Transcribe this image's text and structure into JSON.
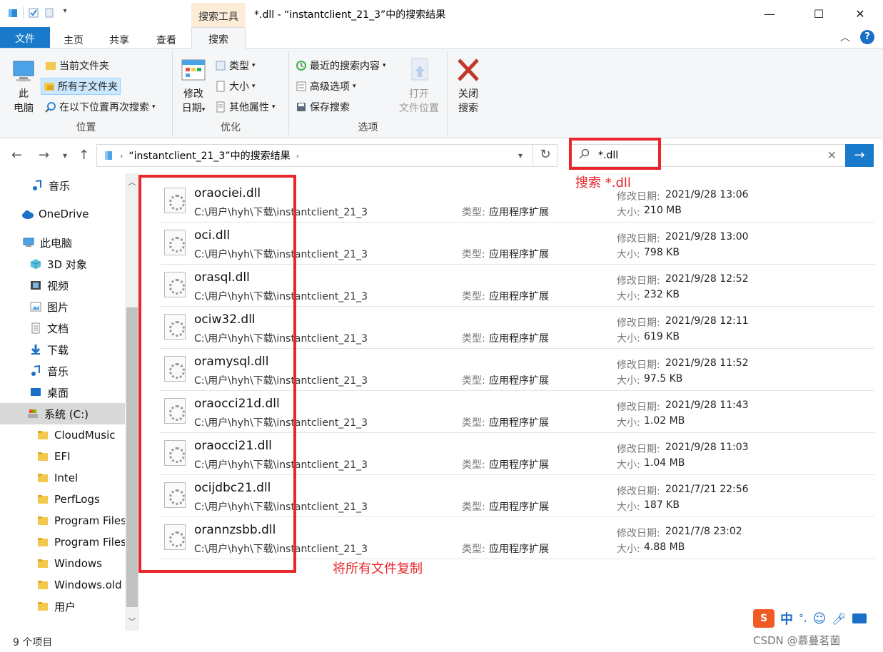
{
  "titlebar": {
    "contextual_tab": "搜索工具",
    "title": "*.dll - “instantclient_21_3”中的搜索结果",
    "minimize": "—",
    "maximize": "☐",
    "close": "✕"
  },
  "tabs": {
    "file": "文件",
    "home": "主页",
    "share": "共享",
    "view": "查看",
    "search": "搜索"
  },
  "ribbon": {
    "location": {
      "label": "位置",
      "this_pc_line1": "此",
      "this_pc_line2": "电脑",
      "current_folder": "当前文件夹",
      "all_subfolders": "所有子文件夹",
      "search_again": "在以下位置再次搜索"
    },
    "refine": {
      "label": "优化",
      "date_modified_line1": "修改",
      "date_modified_line2": "日期",
      "kind": "类型",
      "size": "大小",
      "other_props": "其他属性"
    },
    "options": {
      "label": "选项",
      "recent_searches": "最近的搜索内容",
      "advanced": "高级选项",
      "save_search": "保存搜索",
      "open_location_line1": "打开",
      "open_location_line2": "文件位置"
    },
    "close": {
      "line1": "关闭",
      "line2": "搜索"
    }
  },
  "address": {
    "path": "“instantclient_21_3”中的搜索结果",
    "search_value": "*.dll"
  },
  "sidebar": {
    "items": [
      {
        "label": "音乐",
        "icon": "music-icon"
      },
      {
        "label": "OneDrive",
        "icon": "cloud-icon"
      },
      {
        "label": "此电脑",
        "icon": "computer-icon"
      },
      {
        "label": "3D 对象",
        "icon": "cube-icon"
      },
      {
        "label": "视频",
        "icon": "film-icon"
      },
      {
        "label": "图片",
        "icon": "picture-icon"
      },
      {
        "label": "文档",
        "icon": "document-icon"
      },
      {
        "label": "下载",
        "icon": "download-icon"
      },
      {
        "label": "音乐",
        "icon": "music-icon"
      },
      {
        "label": "桌面",
        "icon": "desktop-icon"
      },
      {
        "label": "系统 (C:)",
        "icon": "drive-icon"
      },
      {
        "label": "CloudMusic",
        "icon": "folder-icon"
      },
      {
        "label": "EFI",
        "icon": "folder-icon"
      },
      {
        "label": "Intel",
        "icon": "folder-icon"
      },
      {
        "label": "PerfLogs",
        "icon": "folder-icon"
      },
      {
        "label": "Program Files",
        "icon": "folder-icon"
      },
      {
        "label": "Program Files",
        "icon": "folder-icon"
      },
      {
        "label": "Windows",
        "icon": "folder-icon"
      },
      {
        "label": "Windows.old",
        "icon": "folder-icon"
      },
      {
        "label": "用户",
        "icon": "folder-icon"
      }
    ]
  },
  "file_labels": {
    "type_label": "类型:",
    "date_label": "修改日期:",
    "size_label": "大小:"
  },
  "files": [
    {
      "name": "oraociei.dll",
      "path": "C:\\用户\\hyh\\下载\\instantclient_21_3",
      "type": "应用程序扩展",
      "date": "2021/9/28 13:06",
      "size": "210 MB"
    },
    {
      "name": "oci.dll",
      "path": "C:\\用户\\hyh\\下载\\instantclient_21_3",
      "type": "应用程序扩展",
      "date": "2021/9/28 13:00",
      "size": "798 KB"
    },
    {
      "name": "orasql.dll",
      "path": "C:\\用户\\hyh\\下载\\instantclient_21_3",
      "type": "应用程序扩展",
      "date": "2021/9/28 12:52",
      "size": "232 KB"
    },
    {
      "name": "ociw32.dll",
      "path": "C:\\用户\\hyh\\下载\\instantclient_21_3",
      "type": "应用程序扩展",
      "date": "2021/9/28 12:11",
      "size": "619 KB"
    },
    {
      "name": "oramysql.dll",
      "path": "C:\\用户\\hyh\\下载\\instantclient_21_3",
      "type": "应用程序扩展",
      "date": "2021/9/28 11:52",
      "size": "97.5 KB"
    },
    {
      "name": "oraocci21d.dll",
      "path": "C:\\用户\\hyh\\下载\\instantclient_21_3",
      "type": "应用程序扩展",
      "date": "2021/9/28 11:43",
      "size": "1.02 MB"
    },
    {
      "name": "oraocci21.dll",
      "path": "C:\\用户\\hyh\\下载\\instantclient_21_3",
      "type": "应用程序扩展",
      "date": "2021/9/28 11:03",
      "size": "1.04 MB"
    },
    {
      "name": "ocijdbc21.dll",
      "path": "C:\\用户\\hyh\\下载\\instantclient_21_3",
      "type": "应用程序扩展",
      "date": "2021/7/21 22:56",
      "size": "187 KB"
    },
    {
      "name": "orannzsbb.dll",
      "path": "C:\\用户\\hyh\\下载\\instantclient_21_3",
      "type": "应用程序扩展",
      "date": "2021/7/8 23:02",
      "size": "4.88 MB"
    }
  ],
  "annotations": {
    "search_note": "搜索 *.dll",
    "copy_note": "将所有文件复制"
  },
  "status": {
    "item_count": "9 个项目"
  },
  "ime": {
    "lang": "中",
    "punct": "°,"
  },
  "watermark": "CSDN @慕蔓茗菌",
  "colors": {
    "accent": "#1979ca",
    "annotation_red": "#e8262b",
    "selected_bg": "#cce8ff"
  }
}
